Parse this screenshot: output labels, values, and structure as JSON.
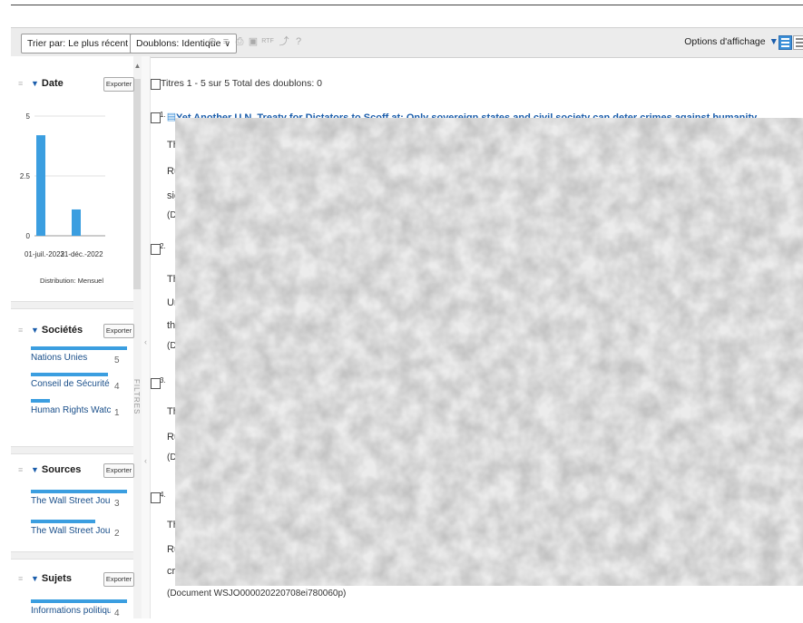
{
  "toolbar": {
    "sort_label": "Trier par: Le plus récent en premier",
    "dup_label": "Doublons: Identique",
    "display_options": "Options d'affichage"
  },
  "sidebar": {
    "filters_label": "FILTRES",
    "date": {
      "title": "Date",
      "export": "Exporter",
      "chart_caption": "Distribution: Mensuel"
    },
    "companies": {
      "title": "Sociétés",
      "export": "Exporter",
      "items": [
        {
          "label": "Nations Unies",
          "count": "5",
          "share": 1.0
        },
        {
          "label": "Conseil de Sécurité des N...",
          "count": "4",
          "share": 0.8
        },
        {
          "label": "Human Rights Watch",
          "count": "1",
          "share": 0.2
        }
      ]
    },
    "sources": {
      "title": "Sources",
      "export": "Exporter",
      "items": [
        {
          "label": "The Wall Street Journal O...",
          "count": "3",
          "share": 1.0
        },
        {
          "label": "The Wall Street Journal",
          "count": "2",
          "share": 0.67
        }
      ]
    },
    "subjects": {
      "title": "Sujets",
      "export": "Exporter",
      "items": [
        {
          "label": "Informations politiques et g...",
          "count": "4",
          "share": 1.0
        }
      ]
    }
  },
  "results": {
    "count_text": "Titres 1 - 5 sur 5 Total des doublons: 0",
    "first_title": "Yet Another U.N. Treaty for Dictators to Scoff at: Only sovereign states and civil society can deter crimes against humanity",
    "numbers": [
      "1.",
      "2.",
      "3.",
      "4."
    ],
    "fragments": [
      "Th",
      "Ru",
      "sig",
      "(Do",
      "Th",
      "Un",
      "tha",
      "(Do",
      "Th",
      "Ru",
      "(Do",
      "Th",
      "Ru",
      "cri"
    ],
    "last_doc_id": "(Document WSJO000020220708ei780060p)"
  },
  "chart_data": {
    "type": "bar",
    "categories": [
      "01-juil.-2022",
      "31-déc.-2022"
    ],
    "values": [
      4.2,
      1.1
    ],
    "title": "",
    "xlabel": "Distribution: Mensuel",
    "ylabel": "",
    "ylim": [
      0,
      5
    ],
    "yticks": [
      "0",
      "2.5",
      "5"
    ],
    "grid": true
  }
}
